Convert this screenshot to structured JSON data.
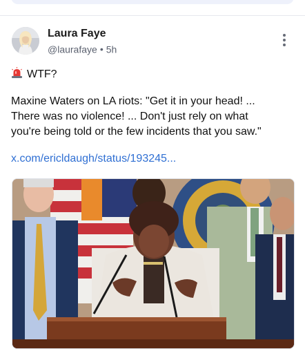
{
  "post": {
    "author_name": "Laura Faye",
    "handle": "@laurafaye",
    "separator": "•",
    "time": "5h",
    "text_line1": "WTF?",
    "text_line2": "Maxine Waters on LA riots: \"Get it in your head! ...",
    "text_line3": "There was no violence! ... Don't just rely on what",
    "text_line4": "you're being told or the few incidents that you saw.\"",
    "link": "x.com/ericldaugh/status/193245...",
    "icons": {
      "siren": "siren-emoji-icon",
      "more": "more-vertical-icon"
    }
  },
  "colors": {
    "link": "#2f6fd3",
    "secondary_text": "#5c6270"
  }
}
